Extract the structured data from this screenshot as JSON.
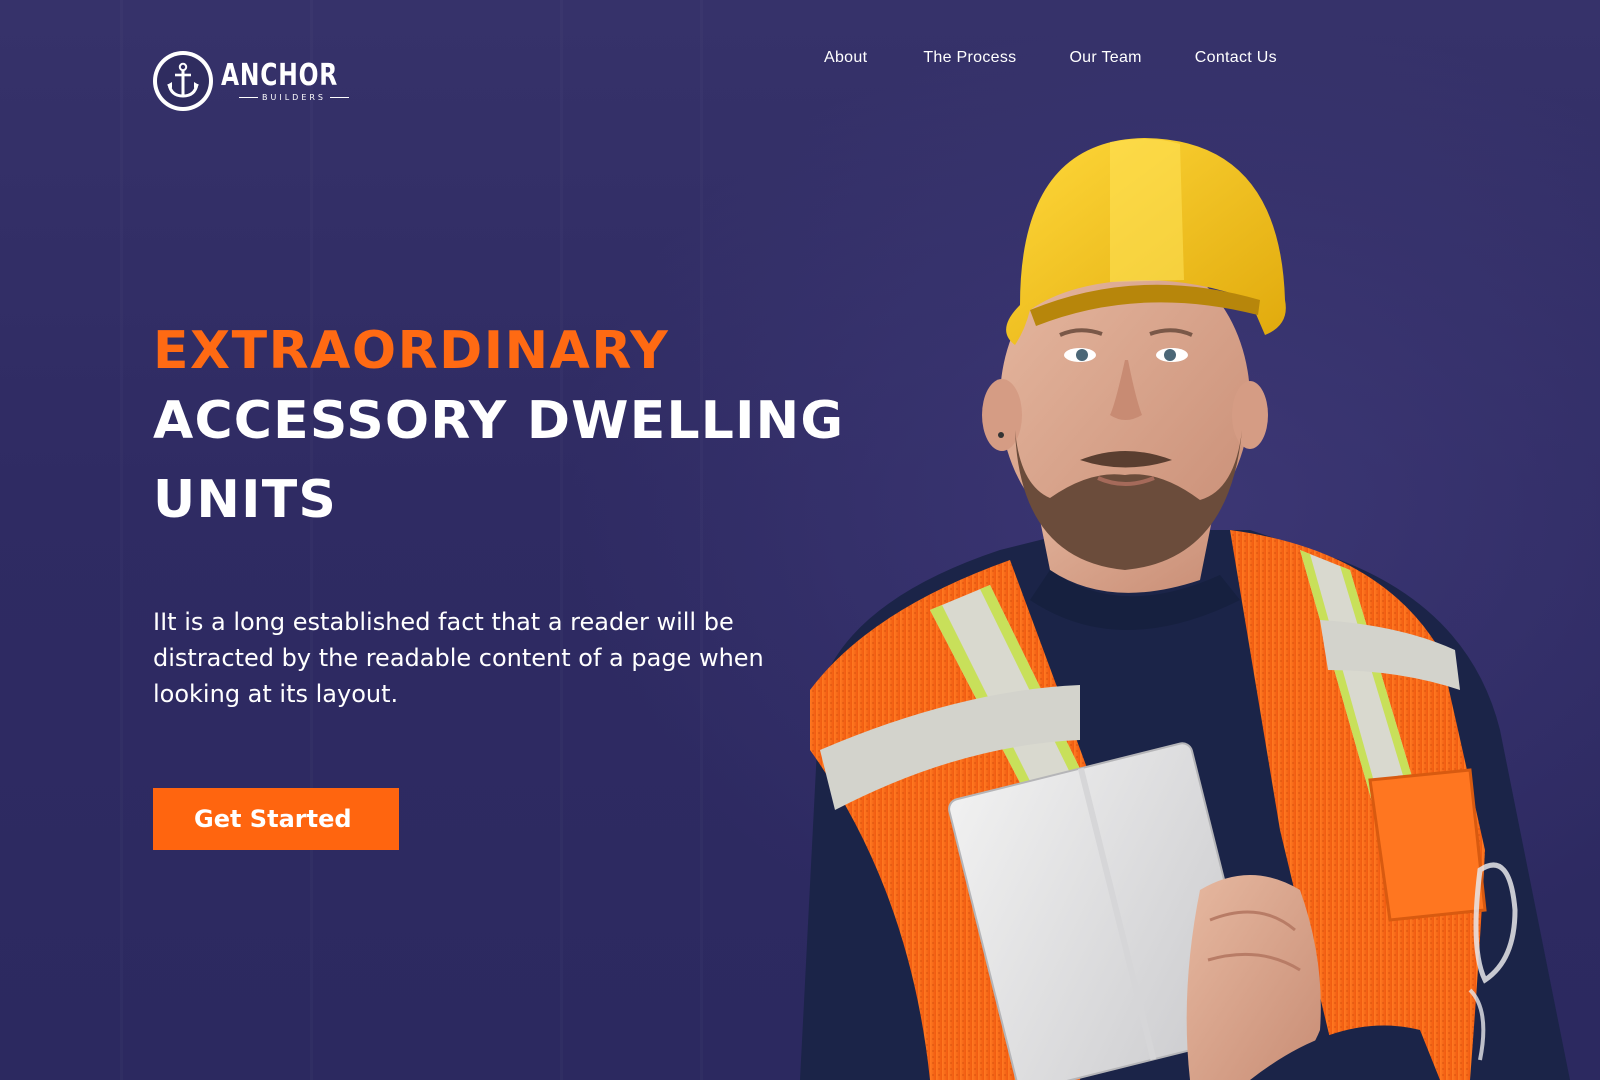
{
  "brand": {
    "name": "ANCHOR",
    "tagline": "BUILDERS"
  },
  "nav": {
    "items": [
      {
        "label": "About"
      },
      {
        "label": "The Process"
      },
      {
        "label": "Our Team"
      },
      {
        "label": "Contact Us"
      }
    ]
  },
  "hero": {
    "headline_accent": "EXTRAORDINARY",
    "headline_line1": "ACCESSORY DWELLING",
    "headline_line2": "UNITS",
    "lead": "IIt is a long established fact that a reader will be distracted by the readable content of a page when looking at its layout.",
    "cta_label": "Get Started"
  },
  "colors": {
    "background": "#2f2c5f",
    "accent": "#ff650f",
    "text": "#ffffff",
    "helmet": "#f5c518",
    "vest": "#ff6a1a"
  },
  "icons": {
    "logo": "anchor-icon"
  }
}
